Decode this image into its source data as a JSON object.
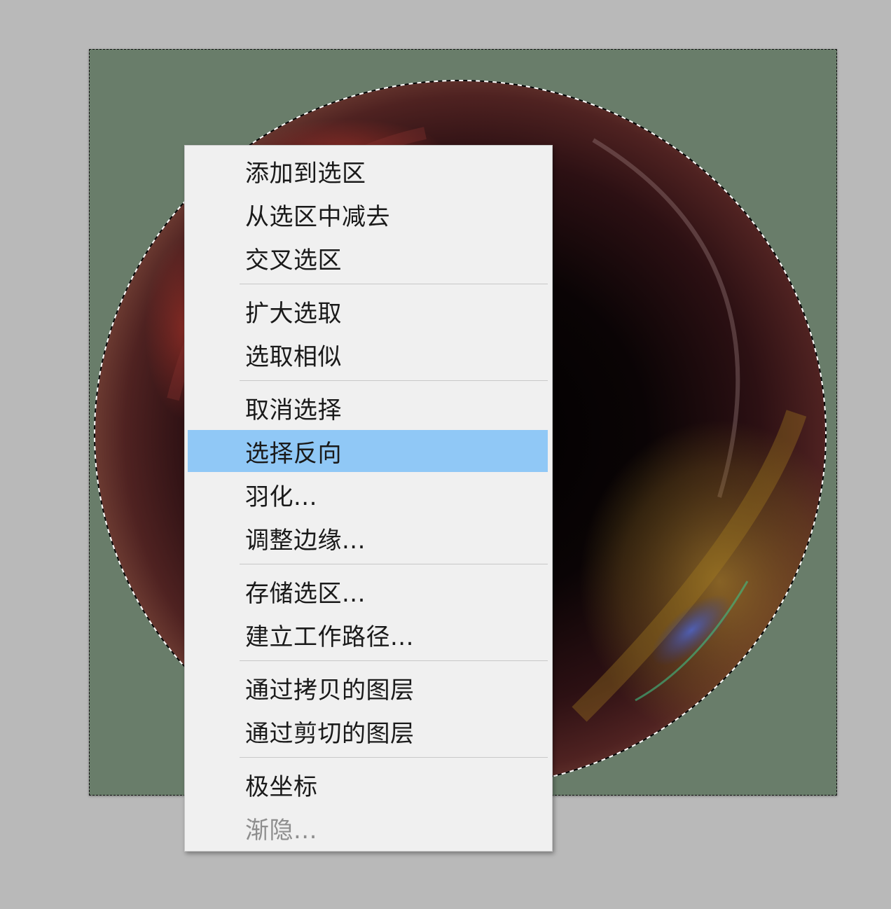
{
  "canvas": {
    "background_color": "#697d6a",
    "sphere_colors": [
      "#6b2f2a",
      "#3a1416",
      "#050203",
      "#c8a030",
      "#3a4ea8"
    ]
  },
  "context_menu": {
    "items": [
      {
        "label": "添加到选区",
        "state": "normal"
      },
      {
        "label": "从选区中减去",
        "state": "normal"
      },
      {
        "label": "交叉选区",
        "state": "normal"
      },
      {
        "label": "扩大选取",
        "state": "normal"
      },
      {
        "label": "选取相似",
        "state": "normal"
      },
      {
        "label": "取消选择",
        "state": "normal"
      },
      {
        "label": "选择反向",
        "state": "highlighted"
      },
      {
        "label": "羽化...",
        "state": "normal"
      },
      {
        "label": "调整边缘...",
        "state": "normal"
      },
      {
        "label": "存储选区...",
        "state": "normal"
      },
      {
        "label": "建立工作路径...",
        "state": "normal"
      },
      {
        "label": "通过拷贝的图层",
        "state": "normal"
      },
      {
        "label": "通过剪切的图层",
        "state": "normal"
      },
      {
        "label": "极坐标",
        "state": "normal"
      },
      {
        "label": "渐隐...",
        "state": "disabled"
      }
    ],
    "highlight_color": "#90c8f6",
    "disabled_text_color": "#8e8e8e"
  }
}
